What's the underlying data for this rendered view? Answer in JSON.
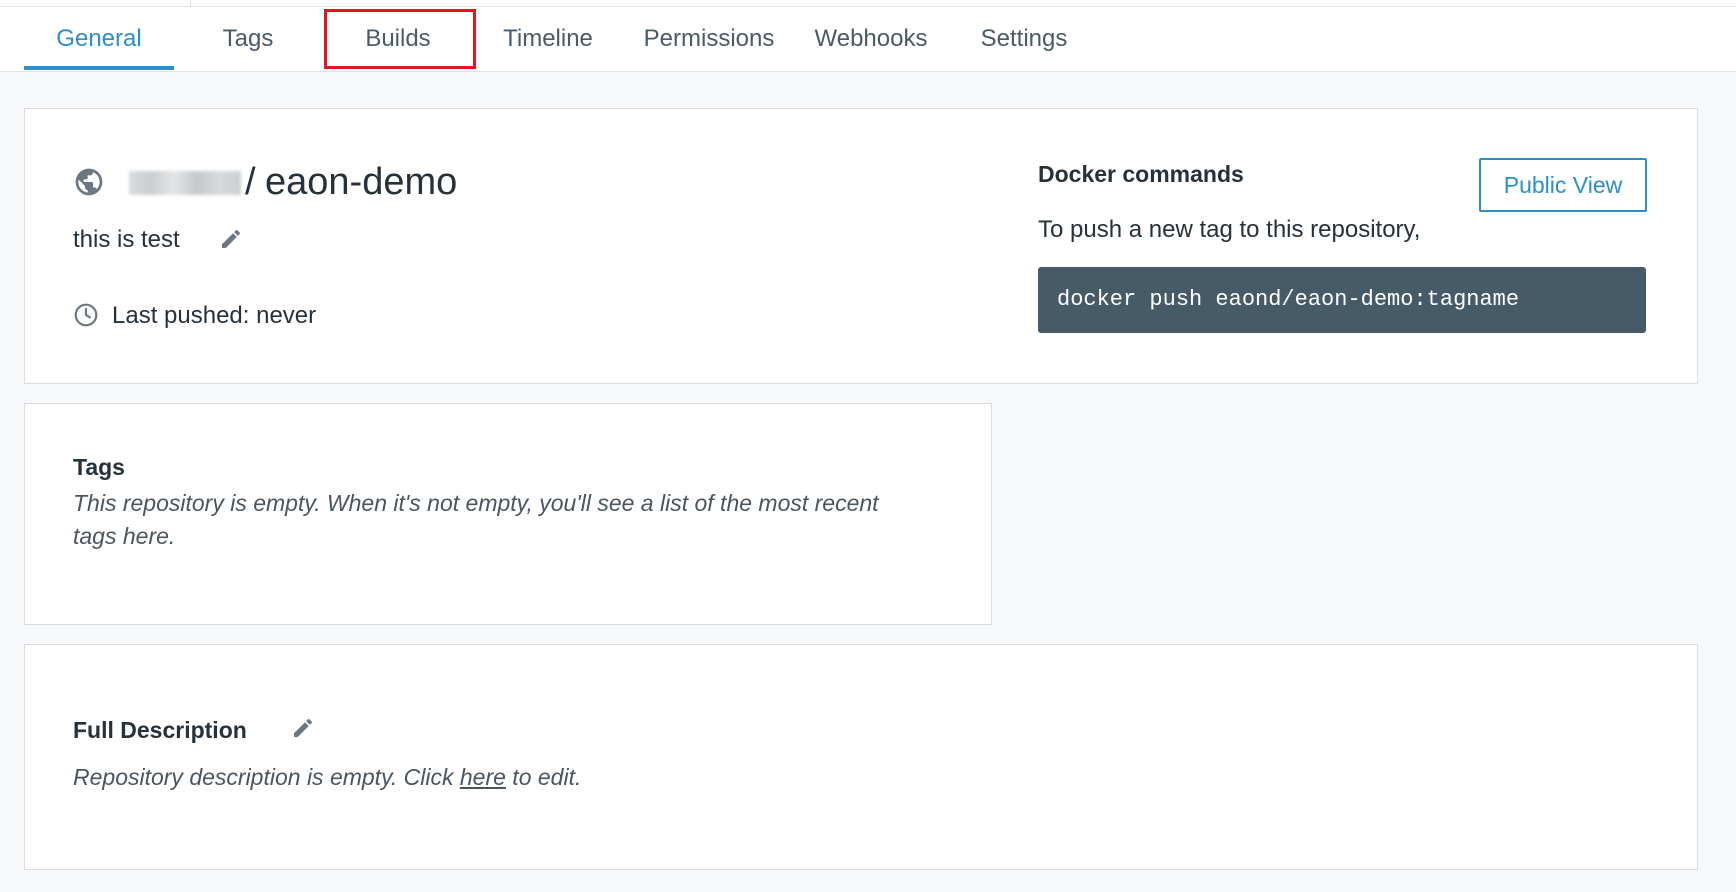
{
  "tabs": [
    {
      "label": "General",
      "active": true
    },
    {
      "label": "Tags"
    },
    {
      "label": "Builds",
      "highlighted": true
    },
    {
      "label": "Timeline"
    },
    {
      "label": "Permissions"
    },
    {
      "label": "Webhooks"
    },
    {
      "label": "Settings"
    }
  ],
  "repo": {
    "owner_redacted": true,
    "separator": "/",
    "name": "eaon-demo",
    "short_description": "this is test",
    "last_pushed": "Last pushed: never"
  },
  "docker": {
    "title": "Docker commands",
    "push_text": "To push a new tag to this repository,",
    "command": "docker push eaond/eaon-demo:tagname",
    "public_view_label": "Public View"
  },
  "tags_card": {
    "title": "Tags",
    "empty_text": "This repository is empty. When it's not empty, you'll see a list of the most recent tags here."
  },
  "full_description": {
    "title": "Full Description",
    "empty_before": "Repository description is empty. Click ",
    "link_text": "here",
    "empty_after": " to edit."
  },
  "colors": {
    "accent": "#2d8ecc",
    "highlight_box": "#e3141e",
    "command_bg": "#465a67"
  },
  "icons": [
    "globe-icon",
    "pencil-icon",
    "clock-icon"
  ]
}
